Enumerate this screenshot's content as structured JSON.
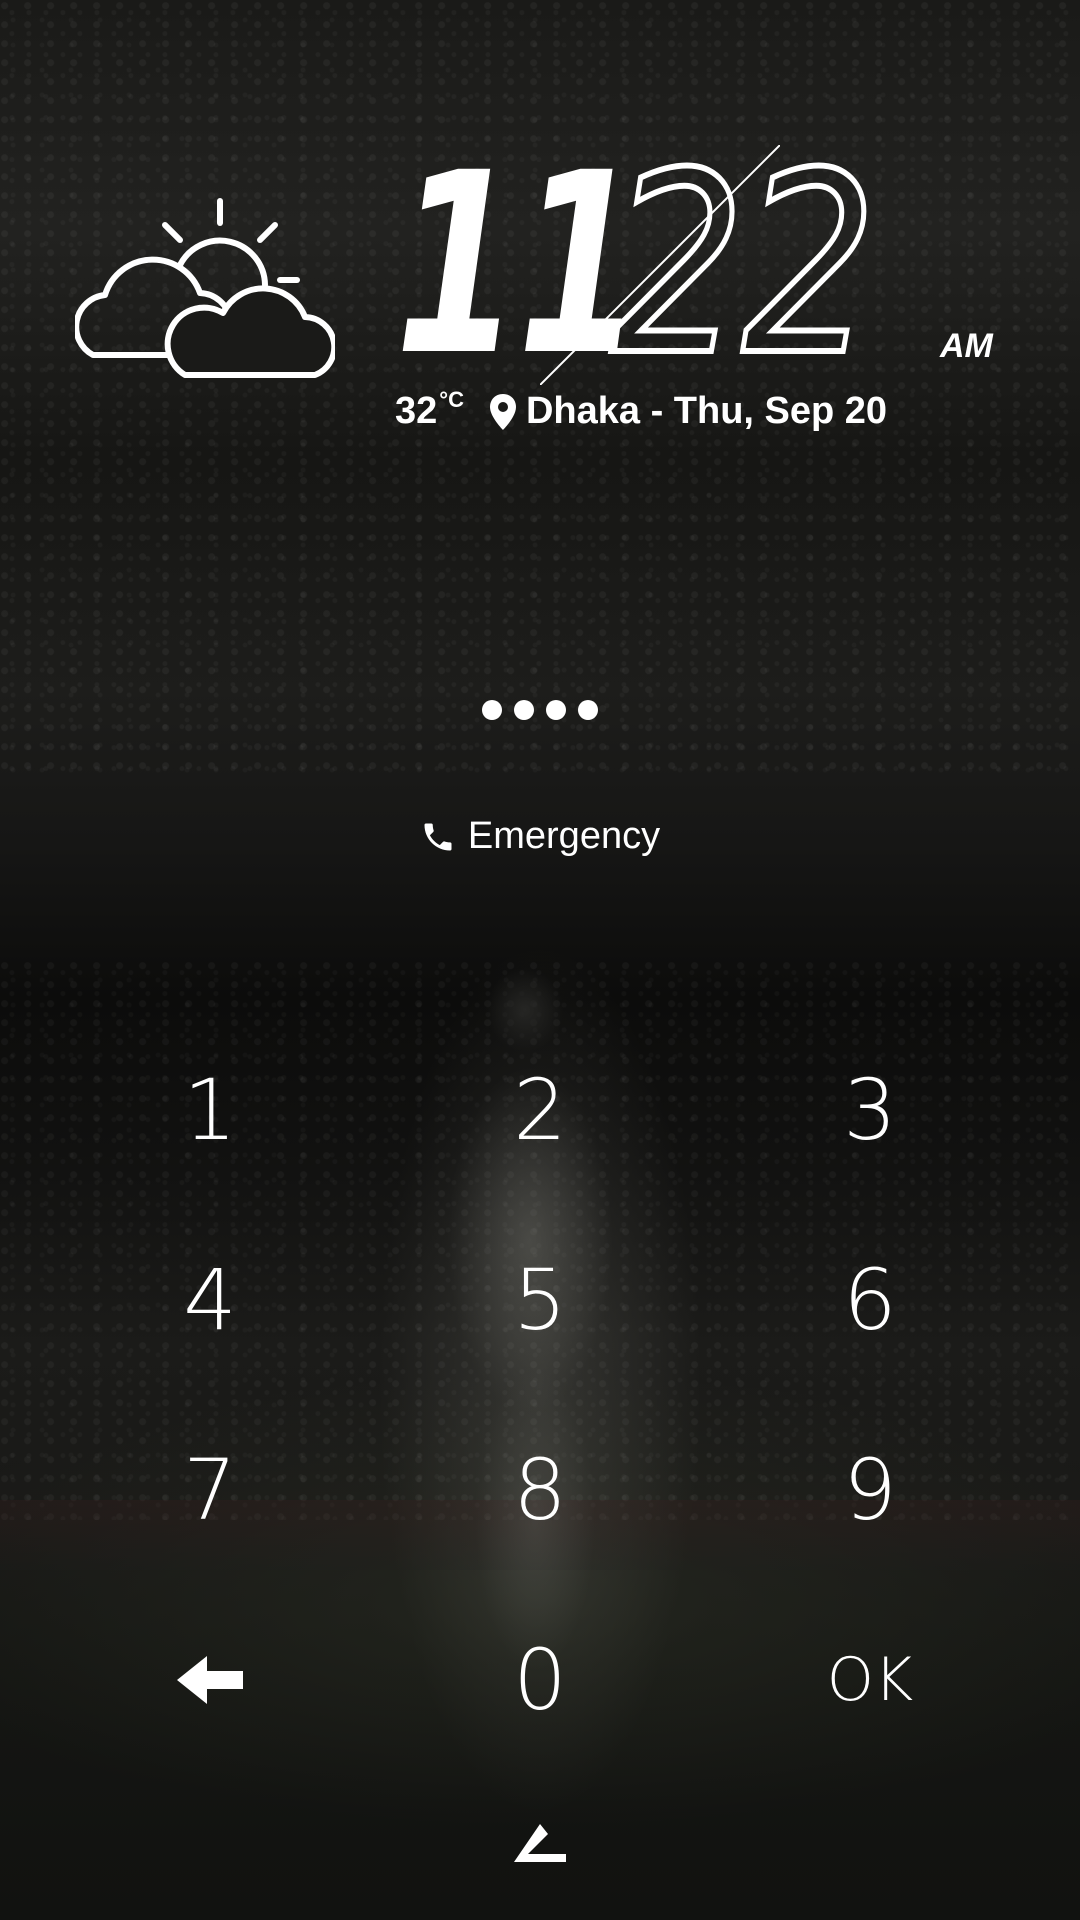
{
  "clock": {
    "hour": "11",
    "minute": "22",
    "ampm": "AM"
  },
  "weather": {
    "icon": "partly-cloudy-icon",
    "temperature": "32",
    "unit": "°C"
  },
  "location_date": "Dhaka - Thu, Sep 20",
  "pin_dots_count": 4,
  "emergency": {
    "label": "Emergency",
    "icon": "phone-icon"
  },
  "keypad": {
    "keys": [
      "1",
      "2",
      "3",
      "4",
      "5",
      "6",
      "7",
      "8",
      "9",
      "0"
    ],
    "ok_label": "OK",
    "back_icon": "backspace-arrow-icon"
  },
  "bottom_icon": "chevron-up-icon",
  "colors": {
    "text": "#ffffff",
    "background": "#161614"
  }
}
